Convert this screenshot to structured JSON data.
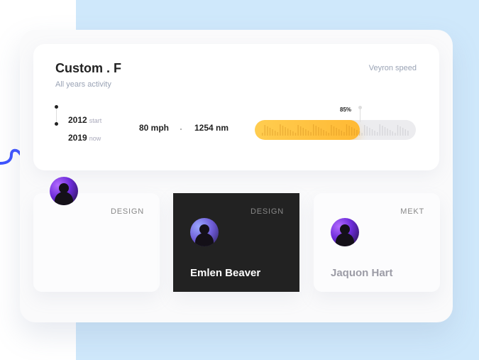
{
  "colors": {
    "background_left": "#ffffff",
    "background_right": "#cfe8fb",
    "panel": "#fafafb",
    "card": "#ffffff",
    "dark_card": "#222222",
    "accent_yellow": "#ffbf3f",
    "accent_blue": "#3d53ff"
  },
  "stats": {
    "title": "Custom . F",
    "subtitle": "All years activity",
    "corner_label": "Veyron speed",
    "years": [
      {
        "year": "2012",
        "note": "start"
      },
      {
        "year": "2019",
        "note": "now"
      }
    ],
    "speed": "80 mph",
    "distance": "1254 nm",
    "progress": {
      "label": "85%",
      "value": 0.65
    }
  },
  "cards": [
    {
      "tag": "DESIGN",
      "name": "",
      "avatar_icon": "person-avatar-icon"
    },
    {
      "tag": "DESIGN",
      "name": "Emlen Beaver",
      "avatar_icon": "person-avatar-icon"
    },
    {
      "tag": "MEKT",
      "name": "Jaquon Hart",
      "avatar_icon": "person-avatar-icon"
    }
  ]
}
